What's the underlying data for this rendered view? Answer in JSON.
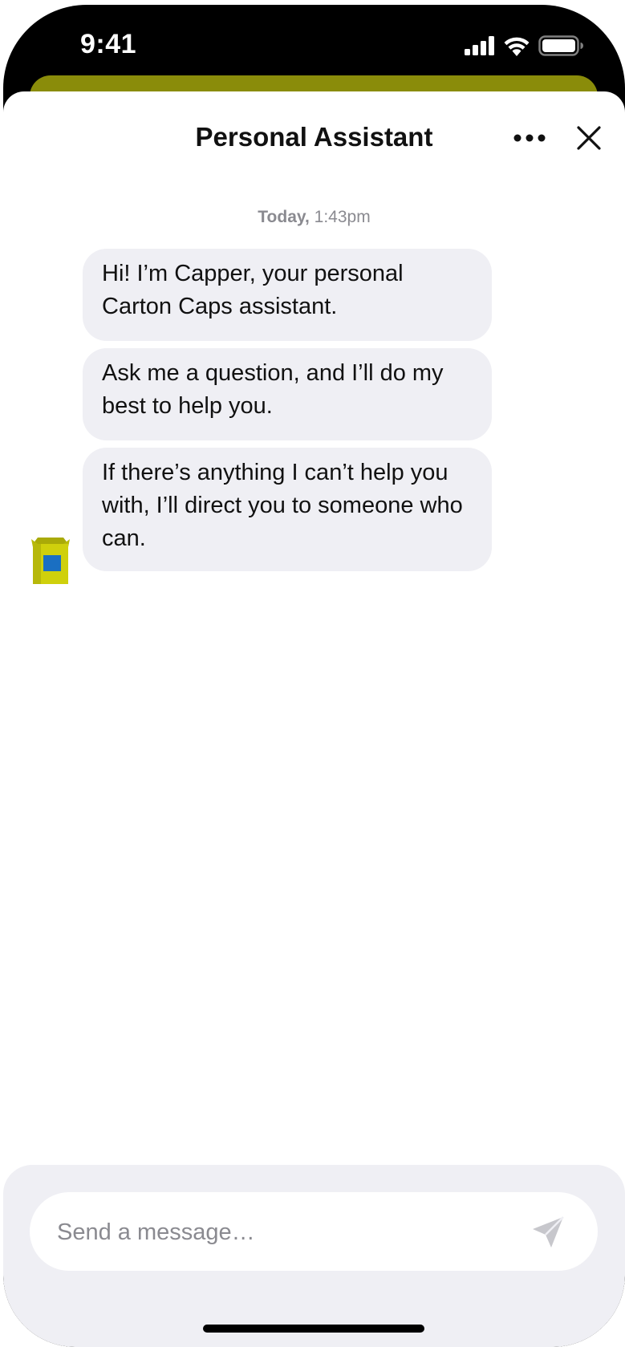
{
  "status_bar": {
    "time": "9:41",
    "icons": [
      "cellular-signal-icon",
      "wifi-icon",
      "battery-icon"
    ]
  },
  "header": {
    "title": "Personal Assistant",
    "more_icon": "more-horizontal-icon",
    "close_icon": "close-icon"
  },
  "conversation": {
    "date_day": "Today,",
    "date_time": "1:43pm",
    "messages": [
      {
        "sender": "assistant",
        "text": "Hi! I’m Capper, your personal Carton Caps assistant."
      },
      {
        "sender": "assistant",
        "text": "Ask me a question, and I’ll do my best to help you."
      },
      {
        "sender": "assistant",
        "text": "If there’s anything I can’t help you with, I’ll direct you to someone who can."
      }
    ],
    "avatar_icon": "carton-box-icon"
  },
  "composer": {
    "placeholder": "Send a message…",
    "value": "",
    "send_icon": "send-icon"
  },
  "colors": {
    "accent_olive": "#8a8c0a",
    "bubble_bg": "#efeff4",
    "avatar_yellow": "#cfd00c",
    "avatar_blue": "#1a6fc2",
    "muted_text": "#8a8a90"
  }
}
